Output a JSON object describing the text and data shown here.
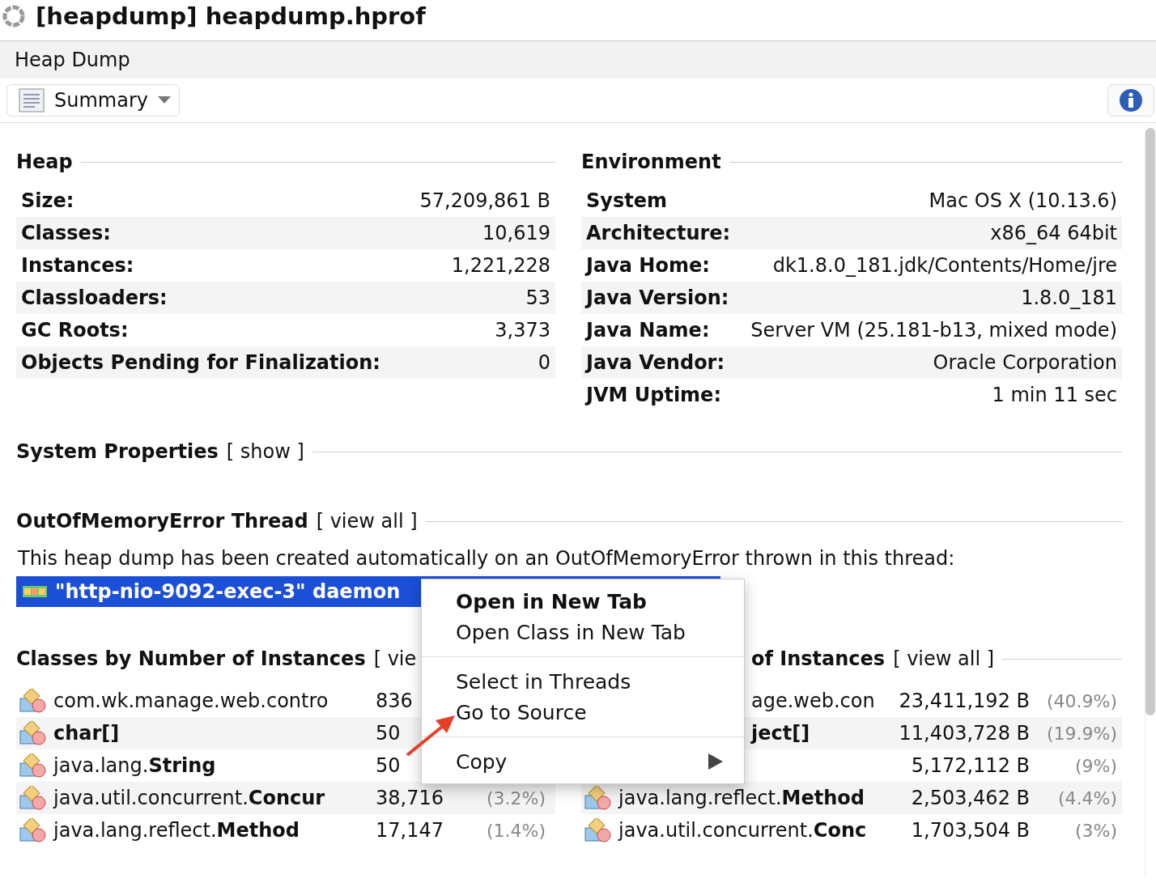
{
  "window": {
    "title": "[heapdump] heapdump.hprof"
  },
  "tab": {
    "label": "Heap Dump",
    "selected": true
  },
  "toolbar": {
    "view": "Summary"
  },
  "heap": {
    "title": "Heap",
    "rows": [
      {
        "label": "Size:",
        "value": "57,209,861 B"
      },
      {
        "label": "Classes:",
        "value": "10,619"
      },
      {
        "label": "Instances:",
        "value": "1,221,228"
      },
      {
        "label": "Classloaders:",
        "value": "53"
      },
      {
        "label": "GC Roots:",
        "value": "3,373"
      },
      {
        "label": "Objects Pending for Finalization:",
        "value": "0"
      }
    ]
  },
  "environment": {
    "title": "Environment",
    "rows": [
      {
        "label": "System",
        "value": "Mac OS X (10.13.6)"
      },
      {
        "label": "Architecture:",
        "value": "x86_64 64bit"
      },
      {
        "label": "Java Home:",
        "value": "dk1.8.0_181.jdk/Contents/Home/jre"
      },
      {
        "label": "Java Version:",
        "value": "1.8.0_181"
      },
      {
        "label": "Java Name:",
        "value": "Server VM (25.181-b13, mixed mode)"
      },
      {
        "label": "Java Vendor:",
        "value": "Oracle Corporation"
      },
      {
        "label": "JVM Uptime:",
        "value": "1 min 11 sec"
      }
    ]
  },
  "system_properties": {
    "title": "System Properties",
    "link": "[ show ]"
  },
  "oome_thread": {
    "title": "OutOfMemoryError Thread",
    "link": "[ view all ]",
    "message": "This heap dump has been created automatically on an OutOfMemoryError thrown in this thread:",
    "thread": {
      "label": "\"http-nio-9092-exec-3\" daemon",
      "selected": true
    }
  },
  "classes_by_instances": {
    "title": "Classes by Number of Instances",
    "link": "[ vie",
    "rows": [
      {
        "name": "com.wk.manage.web.contro",
        "bold": false,
        "count": "836"
      },
      {
        "name": "char[]",
        "bold": true,
        "count": "50"
      },
      {
        "name": "java.lang.**String**",
        "bold": false,
        "count": "50"
      },
      {
        "name": "java.util.concurrent.**Concur**",
        "bold": false,
        "count": "38,716",
        "percent": "(3.2%)"
      },
      {
        "name": "java.lang.reflect.**Method**",
        "bold": false,
        "count": "17,147",
        "percent": "(1.4%)"
      }
    ]
  },
  "classes_by_size": {
    "title": "of Instances",
    "link": "[ view all ]",
    "rows": [
      {
        "icon": false,
        "name": "age.web.con",
        "bold": false,
        "size": "23,411,192 B",
        "percent": "(40.9%)"
      },
      {
        "icon": false,
        "name": "ject[]",
        "bold": true,
        "size": "11,403,728 B",
        "percent": "(19.9%)"
      },
      {
        "size": "5,172,112 B",
        "percent": "(9%)"
      },
      {
        "icon": true,
        "name": "java.lang.reflect.**Method**",
        "bold": false,
        "size": "2,503,462 B",
        "percent": "(4.4%)"
      },
      {
        "icon": true,
        "name": "java.util.concurrent.**Conc**",
        "bold": false,
        "size": "1,703,504 B",
        "percent": "(3%)"
      }
    ]
  },
  "context_menu": {
    "items": [
      {
        "kind": "item",
        "label": "Open in New Tab",
        "bold": true
      },
      {
        "kind": "item",
        "label": "Open Class in New Tab",
        "bold": false
      },
      {
        "kind": "separator"
      },
      {
        "kind": "item",
        "label": "Select in Threads",
        "bold": false
      },
      {
        "kind": "item",
        "label": "Go to Source",
        "bold": false
      },
      {
        "kind": "separator"
      },
      {
        "kind": "submenu",
        "label": "Copy",
        "bold": false
      }
    ]
  }
}
